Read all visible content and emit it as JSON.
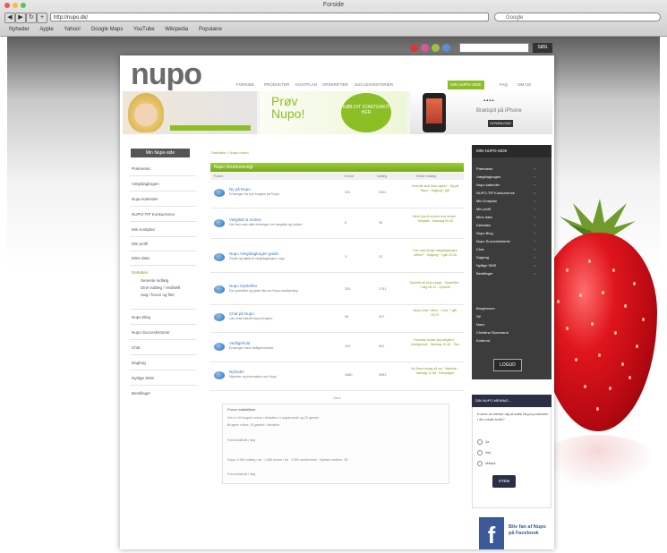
{
  "browser": {
    "title": "Forside",
    "url": "http://nupo.dk/",
    "search_placeholder": "Google",
    "bookmarks": [
      "Nyheder",
      "Apple",
      "Yahoo!",
      "Google Maps",
      "YouTube",
      "Wikipedia",
      "Populære"
    ],
    "light_colors": [
      "#ee5b53",
      "#f5be3f",
      "#5fc252"
    ]
  },
  "header": {
    "logo": "nupo",
    "nav": [
      "FORSIDE",
      "PRODUKTER",
      "KOSTPLAN",
      "OPSKRIFTER",
      "SUCCESHISTORIER",
      "MIN NUPO-SIDE",
      "FAQ",
      "OM OS"
    ],
    "active_nav": "MIN NUPO-SIDE",
    "search_button": "SØG"
  },
  "banner": {
    "prov_line1": "Prøv",
    "prov_line2": "Nupo!",
    "circle_text": "KØB DIT STARTERKIT HER",
    "iphone_label": "Brætspil på iPhone",
    "iphone_button": "DOWNLOAD"
  },
  "left_nav": {
    "button": "Min Nupo-side",
    "items": [
      "Præmietur",
      "Vægtdagbogen",
      "Nupo-kalender",
      "NUPO-TIP Konkurrence",
      "Min Kostplan",
      "Min profil",
      "Mine data",
      "Debatten"
    ],
    "debatten_sub": [
      "Seneste indlæg",
      "Dine indlæg / Vedhæft",
      "Søg i forum og filer"
    ],
    "items_after": [
      "Nupo Blog",
      "Nupo Succeshistorier",
      "Chat",
      "Dagbog",
      "Nyttige SMS",
      "Bestilinger"
    ]
  },
  "main": {
    "breadcrumb": "Debatten » Nupo forum",
    "forum_header": "Nupo forumoversigt",
    "columns": [
      "Forum",
      "Emner",
      "Indlæg",
      "Sidste indlæg"
    ],
    "forums": [
      {
        "title": "Ny på Nupo",
        "desc": "Erfaringer fra nye brugere på Nupo",
        "topics": "311",
        "posts": "2091",
        "last": "Hvornår skal man nøjes? · Ny på Nupo · Dagbog i går"
      },
      {
        "title": "Vægttab & motion",
        "desc": "Her kan man dele erfaringer om vægttab og motion",
        "topics": "6",
        "posts": "39",
        "last": "Mere lyst til motion end ventet · Vægttab · Mandag 09.40"
      },
      {
        "title": "Nupo Vægtdagbogen guide",
        "desc": "Guide og hjælp til vægtdagbogen i app",
        "topics": "3",
        "posts": "12",
        "last": "Kan man bruge vægtdagbogen offline? · Dagbog · I går 13.40"
      },
      {
        "title": "Nupo Opskrifter",
        "desc": "Del opskrifter og gode råd om Nupo-madlavning",
        "topics": "204",
        "posts": "1741",
        "last": "Opskrift på Nupo-kage · Opskrifter · I dag 08.11 · Opskrift"
      },
      {
        "title": "Chat på Nupo",
        "desc": "Løs snak blandt Nupo-brugere",
        "topics": "90",
        "posts": "427",
        "last": "Nupo-chat i aften · Chat · I går 20.01"
      },
      {
        "title": "Vedligehold",
        "desc": "Erfaringer med vedligeholdelse",
        "topics": "119",
        "posts": "651",
        "last": "Hvordan holder jeg vægten? · Vedligehold · Søndag 10.45 · Tips"
      },
      {
        "title": "Nyheder",
        "desc": "Nyheder og information om Nupo",
        "topics": "1580",
        "posts": "9981",
        "last": "Ny Nupo-smag på vej · Nyheder · Søndag 11.58 · Kampagne"
      }
    ],
    "forum_footer": "Mark",
    "stats_title": "Forum statistikker",
    "stats_lines": [
      "Der er 19 brugere online i debatten: 4 registrerede og 15 gæster",
      "Brugere online: 15 gæster i debatten",
      "Forumstatistik i dag",
      "Nupo: 9.981 indlæg i alt · 1.580 emner i alt · 3.500 medlemmer · Nyeste medlem: Sif",
      "Forumstatistik i dag"
    ]
  },
  "right_bar": {
    "title": "MIN NUPO-SIDE",
    "items": [
      "Præmietur",
      "Vægtdagbogen",
      "Nupo-kalender",
      "NUPO-TIP Konkurrence",
      "Min Kostplan",
      "Min profil",
      "Mine data",
      "Debatten",
      "Nupo Blog",
      "Nupo Succeshistorier",
      "Chat",
      "Dagbog",
      "Nyttige SMS",
      "Bestilinger"
    ],
    "user_lines": [
      "Brugernavn",
      "Sif",
      "Navn",
      "Christina Skovmand",
      "Kodeord"
    ],
    "logout": "LOGUD"
  },
  "poll": {
    "title": "DIN NUPO MENING...",
    "question": "Kunne du tænke dig at købe Nupo-produkter i din lokale butik?",
    "options": [
      "Ja",
      "Nej",
      "Måske"
    ],
    "button": "STEM"
  },
  "facebook": {
    "logo": "f",
    "text": "Bliv fan af Nupo på Facebook"
  },
  "colors": {
    "brand_green": "#8cbf26",
    "dark_sidebar": "#3c3c3c",
    "poll_navy": "#2b2e44",
    "facebook_blue": "#3b5998"
  }
}
